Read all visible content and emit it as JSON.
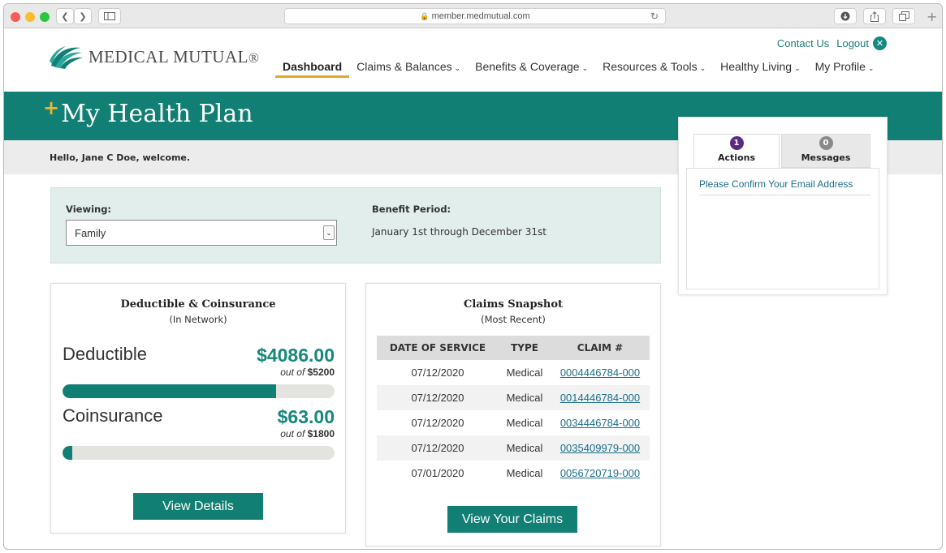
{
  "browser": {
    "url": "member.medmutual.com"
  },
  "colors": {
    "brand_teal": "#127f74",
    "accent_gold": "#e2a726",
    "link_blue": "#1b6f8c",
    "actions_badge": "#5b2a83",
    "messages_badge": "#8a8a8a"
  },
  "header": {
    "logo_text_main": "MEDICAL MUTUAL",
    "logo_mark": "®",
    "contact_us": "Contact Us",
    "logout": "Logout"
  },
  "nav": {
    "items": [
      {
        "label": "Dashboard"
      },
      {
        "label": "Claims & Balances"
      },
      {
        "label": "Benefits & Coverage"
      },
      {
        "label": "Resources & Tools"
      },
      {
        "label": "Healthy Living"
      },
      {
        "label": "My Profile"
      }
    ]
  },
  "banner": {
    "title": "My Health Plan",
    "welcome": "Hello, Jane C Doe, welcome."
  },
  "viewing": {
    "label": "Viewing:",
    "selected": "Family",
    "period_label": "Benefit Period:",
    "period_value": "January 1st through December 31st"
  },
  "deductible_card": {
    "title": "Deductible & Coinsurance",
    "subtitle": "(In Network)",
    "deductible_label": "Deductible",
    "deductible_value": "$4086.00",
    "deductible_out_prefix": "out of",
    "deductible_out_total": "$5200",
    "deductible_progress": 0.786,
    "coinsurance_label": "Coinsurance",
    "coinsurance_value": "$63.00",
    "coinsurance_out_prefix": "out of",
    "coinsurance_out_total": "$1800",
    "coinsurance_progress": 0.035,
    "button": "View Details"
  },
  "claims_card": {
    "title": "Claims Snapshot",
    "subtitle": "(Most Recent)",
    "columns": [
      "DATE OF SERVICE",
      "TYPE",
      "CLAIM #"
    ],
    "rows": [
      {
        "date": "07/12/2020",
        "type": "Medical",
        "claim": "0004446784-000"
      },
      {
        "date": "07/12/2020",
        "type": "Medical",
        "claim": "0014446784-000"
      },
      {
        "date": "07/12/2020",
        "type": "Medical",
        "claim": "0034446784-000"
      },
      {
        "date": "07/12/2020",
        "type": "Medical",
        "claim": "0035409979-000"
      },
      {
        "date": "07/01/2020",
        "type": "Medical",
        "claim": "0056720719-000"
      }
    ],
    "button": "View Your Claims"
  },
  "actions_panel": {
    "tab_actions": "Actions",
    "tab_actions_count": "1",
    "tab_messages": "Messages",
    "tab_messages_count": "0",
    "items": [
      "Please Confirm Your Email Address"
    ]
  }
}
